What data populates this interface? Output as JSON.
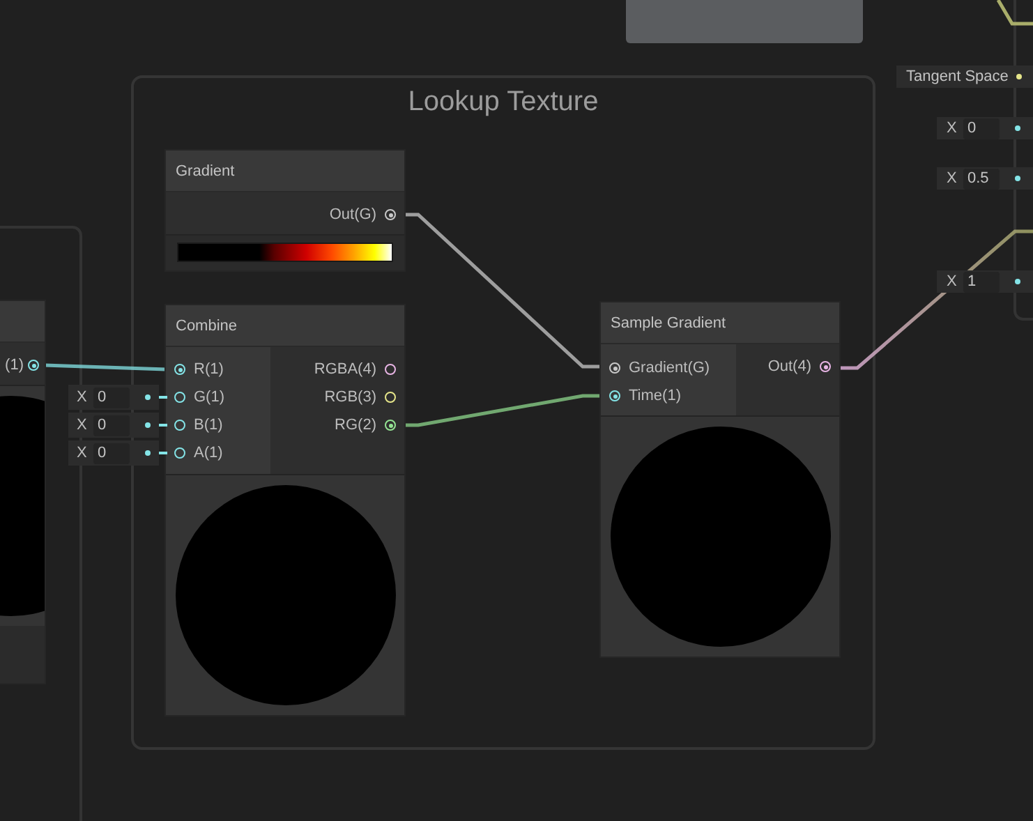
{
  "group": {
    "title": "Lookup Texture"
  },
  "partial_node": {
    "outputs": [
      {
        "label": "(1)",
        "color": "#84e4e7",
        "connected": true
      }
    ]
  },
  "gradient_node": {
    "title": "Gradient",
    "outputs": [
      {
        "label": "Out(G)",
        "color": "#c8c8c8",
        "connected": true
      }
    ]
  },
  "combine_node": {
    "title": "Combine",
    "inputs": [
      {
        "label": "R(1)",
        "color": "#84e4e7",
        "connected": true
      },
      {
        "label": "G(1)",
        "color": "#84e4e7",
        "connected": false,
        "axis": "X",
        "value": "0"
      },
      {
        "label": "B(1)",
        "color": "#84e4e7",
        "connected": false,
        "axis": "X",
        "value": "0"
      },
      {
        "label": "A(1)",
        "color": "#84e4e7",
        "connected": false,
        "axis": "X",
        "value": "0"
      }
    ],
    "outputs": [
      {
        "label": "RGBA(4)",
        "color": "#e7b4e4",
        "connected": false
      },
      {
        "label": "RGB(3)",
        "color": "#e5e58a",
        "connected": false
      },
      {
        "label": "RG(2)",
        "color": "#94e393",
        "connected": true
      }
    ]
  },
  "sample_gradient_node": {
    "title": "Sample Gradient",
    "inputs": [
      {
        "label": "Gradient(G)",
        "color": "#c8c8c8",
        "connected": true
      },
      {
        "label": "Time(1)",
        "color": "#84e4e7",
        "connected": true
      }
    ],
    "outputs": [
      {
        "label": "Out(4)",
        "color": "#e7b4e4",
        "connected": true
      }
    ]
  },
  "side_inputs": [
    {
      "kind": "space",
      "label": "Tangent Space",
      "color": "#e5e58a"
    },
    {
      "kind": "vector",
      "axis": "X",
      "value": "0",
      "color": "#84e4e7"
    },
    {
      "kind": "vector",
      "axis": "X",
      "value": "0.5",
      "color": "#84e4e7"
    },
    {
      "kind": "vector",
      "axis": "X",
      "value": "1",
      "color": "#84e4e7"
    }
  ]
}
